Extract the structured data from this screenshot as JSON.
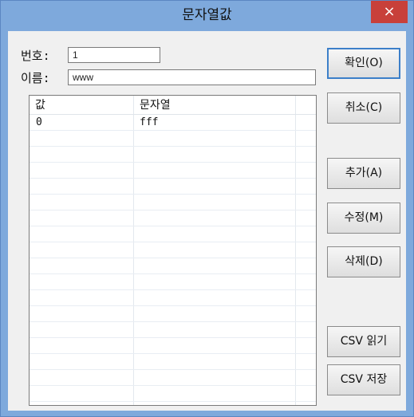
{
  "window": {
    "title": "문자열값",
    "close_glyph": "×"
  },
  "form": {
    "number_label": "번호:",
    "number_value": "1",
    "name_label": "이름:",
    "name_value": "www"
  },
  "table": {
    "columns": [
      "값",
      "문자열"
    ],
    "rows": [
      {
        "value": "0",
        "string": "fff"
      }
    ]
  },
  "buttons": {
    "ok": "확인(O)",
    "cancel": "취소(C)",
    "add": "추가(A)",
    "edit": "수정(M)",
    "delete": "삭제(D)",
    "csv_read": "CSV 읽기",
    "csv_save": "CSV 저장"
  },
  "colors": {
    "titlebar": "#7ea9dc",
    "close": "#c8403a",
    "default_button_border": "#3c7fc9"
  }
}
